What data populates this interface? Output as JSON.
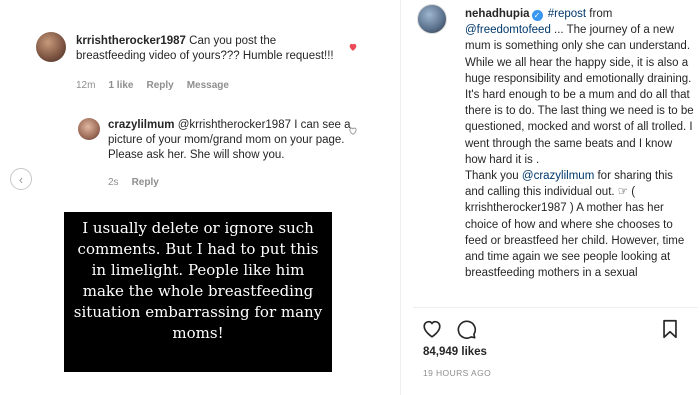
{
  "comments": {
    "main": {
      "username": "krrishtherocker1987",
      "text": "Can you post the breastfeeding video of yours??? Humble request!!!",
      "time": "12m",
      "likes": "1 like",
      "reply_label": "Reply",
      "message_label": "Message"
    },
    "reply": {
      "username": "crazylilmum",
      "mention": "@krrishtherocker1987",
      "text": "I can see a picture of your mom/grand mom on your page. Please ask her. She will show you.",
      "time": "2s",
      "reply_label": "Reply"
    }
  },
  "story_note": "I usually delete or ignore such comments. But I had to put this in limelight. People like him make the whole breastfeeding situation embarrassing for many moms!",
  "post": {
    "username": "nehadhupia",
    "repost_tag": "#repost",
    "from_text": "from",
    "source_mention": "@freedomtofeed",
    "caption_part1": "... The journey of a new mum is something only she can understand. While we all hear the happy side, it is also a huge responsibility and emotionally draining. It's hard enough to be a mum and do all that there is to do. The last thing we need is to be questioned, mocked and worst of all trolled. I went through the same beats and I know how hard it is .",
    "caption_thanks": "Thank you",
    "thanks_mention": "@crazylilmum",
    "caption_part2": "for sharing this and calling this individual out. ☞ ( krrishtherocker1987 ) A mother has her choice of how and where she chooses to feed or breastfeed her child. However, time and time again we see people looking at breastfeeding mothers in a sexual",
    "likes": "84,949 likes",
    "timestamp": "19 HOURS AGO"
  },
  "icons": {
    "heart_filled_color": "#ed4956",
    "verified_color": "#3897f0",
    "like": "heart-outline-icon",
    "comment": "comment-icon",
    "bookmark": "bookmark-icon",
    "nav": "chevron-left-icon"
  }
}
